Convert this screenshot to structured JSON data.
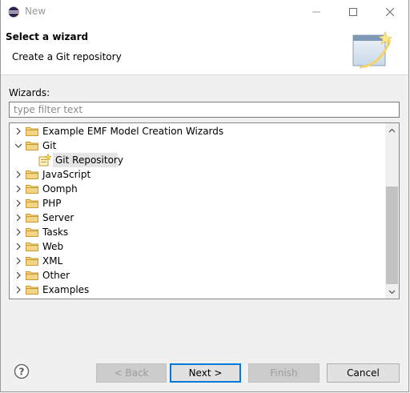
{
  "window": {
    "title": "New"
  },
  "header": {
    "title": "Select a wizard",
    "description": "Create a Git repository"
  },
  "wizards": {
    "label": "Wizards:",
    "filter_placeholder": "type filter text",
    "filter_value": "",
    "items": [
      {
        "label": "Example EMF Model Creation Wizards",
        "expanded": false
      },
      {
        "label": "Git",
        "expanded": true,
        "children": [
          {
            "label": "Git Repository",
            "selected": true
          }
        ]
      },
      {
        "label": "JavaScript",
        "expanded": false
      },
      {
        "label": "Oomph",
        "expanded": false
      },
      {
        "label": "PHP",
        "expanded": false
      },
      {
        "label": "Server",
        "expanded": false
      },
      {
        "label": "Tasks",
        "expanded": false
      },
      {
        "label": "Web",
        "expanded": false
      },
      {
        "label": "XML",
        "expanded": false
      },
      {
        "label": "Other",
        "expanded": false
      },
      {
        "label": "Examples",
        "expanded": false
      }
    ]
  },
  "buttons": {
    "back": "< Back",
    "next": "Next >",
    "finish": "Finish",
    "cancel": "Cancel"
  },
  "icons": {
    "app": "eclipse-icon",
    "help": "help-icon",
    "folder": "folder-icon",
    "git_repo": "git-repository-icon"
  },
  "colors": {
    "default_button_border": "#0078d7",
    "folder": "#dcb14a",
    "selection": "#e5e5e5"
  }
}
